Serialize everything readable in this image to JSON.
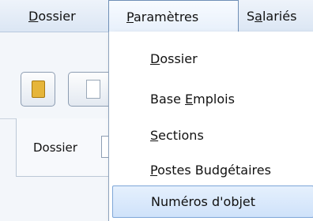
{
  "menubar": {
    "items": [
      {
        "pre": "",
        "key": "D",
        "post": "ossier"
      },
      {
        "pre": "",
        "key": "P",
        "post": "aramètres"
      },
      {
        "pre": "S",
        "key": "a",
        "post": "lariés"
      }
    ]
  },
  "dropdown": {
    "items": [
      {
        "pre": "",
        "key": "D",
        "post": "ossier"
      },
      {
        "pre": "Base ",
        "key": "E",
        "post": "mplois"
      },
      {
        "pre": "",
        "key": "S",
        "post": "ections"
      },
      {
        "pre": "",
        "key": "P",
        "post": "ostes Budgétaires"
      },
      {
        "pre": "Numéros d'objet",
        "key": "",
        "post": ""
      }
    ],
    "highlighted_index": 4
  },
  "form": {
    "dossier_label": "Dossier"
  },
  "icons": [
    "folder-icon",
    "document-icon"
  ],
  "colors": {
    "highlight_bg": "#cfe2fa",
    "highlight_border": "#7ea6d8",
    "menubar_bg": "#dbe6f4"
  }
}
